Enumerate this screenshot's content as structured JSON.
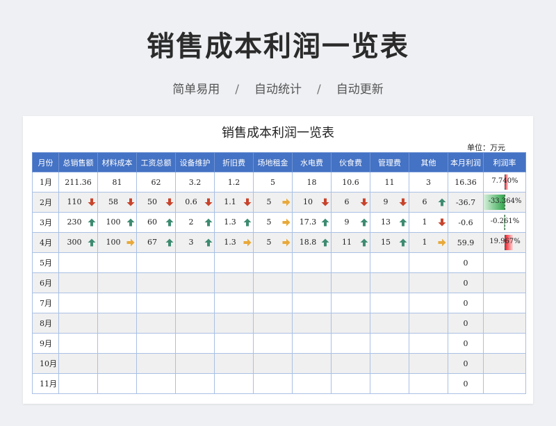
{
  "hero": {
    "title": "销售成本利润一览表",
    "tags": [
      "简单易用",
      "自动统计",
      "自动更新"
    ],
    "separator": "/"
  },
  "sheet": {
    "title": "销售成本利润一览表",
    "unit": "单位：万元",
    "headers": [
      "月份",
      "总销售额",
      "材料成本",
      "工资总额",
      "设备维护",
      "折旧费",
      "场地租金",
      "水电费",
      "伙食费",
      "管理费",
      "其他",
      "本月利润",
      "利润率"
    ],
    "rows": [
      {
        "month": "1月",
        "cells": [
          {
            "v": "211.36",
            "i": ""
          },
          {
            "v": "81",
            "i": ""
          },
          {
            "v": "62",
            "i": ""
          },
          {
            "v": "3.2",
            "i": ""
          },
          {
            "v": "1.2",
            "i": ""
          },
          {
            "v": "5",
            "i": ""
          },
          {
            "v": "18",
            "i": ""
          },
          {
            "v": "10.6",
            "i": ""
          },
          {
            "v": "11",
            "i": ""
          },
          {
            "v": "3",
            "i": ""
          }
        ],
        "profit": "16.36",
        "rate": "7.740%",
        "rate_value": 7.74
      },
      {
        "month": "2月",
        "cells": [
          {
            "v": "110",
            "i": "down"
          },
          {
            "v": "58",
            "i": "down"
          },
          {
            "v": "50",
            "i": "down"
          },
          {
            "v": "0.6",
            "i": "down"
          },
          {
            "v": "1.1",
            "i": "down"
          },
          {
            "v": "5",
            "i": "right"
          },
          {
            "v": "10",
            "i": "down"
          },
          {
            "v": "6",
            "i": "down"
          },
          {
            "v": "9",
            "i": "down"
          },
          {
            "v": "6",
            "i": "up"
          }
        ],
        "profit": "-36.7",
        "rate": "-33.364%",
        "rate_value": -33.364
      },
      {
        "month": "3月",
        "cells": [
          {
            "v": "230",
            "i": "up"
          },
          {
            "v": "100",
            "i": "up"
          },
          {
            "v": "60",
            "i": "up"
          },
          {
            "v": "2",
            "i": "up"
          },
          {
            "v": "1.3",
            "i": "up"
          },
          {
            "v": "5",
            "i": "right"
          },
          {
            "v": "17.3",
            "i": "up"
          },
          {
            "v": "9",
            "i": "up"
          },
          {
            "v": "13",
            "i": "up"
          },
          {
            "v": "1",
            "i": "down"
          }
        ],
        "profit": "-0.6",
        "rate": "-0.261%",
        "rate_value": -0.261
      },
      {
        "month": "4月",
        "cells": [
          {
            "v": "300",
            "i": "up"
          },
          {
            "v": "100",
            "i": "right"
          },
          {
            "v": "67",
            "i": "up"
          },
          {
            "v": "3",
            "i": "up"
          },
          {
            "v": "1.3",
            "i": "right"
          },
          {
            "v": "5",
            "i": "right"
          },
          {
            "v": "18.8",
            "i": "up"
          },
          {
            "v": "11",
            "i": "up"
          },
          {
            "v": "15",
            "i": "up"
          },
          {
            "v": "1",
            "i": "right"
          }
        ],
        "profit": "59.9",
        "rate": "19.967%",
        "rate_value": 19.967
      },
      {
        "month": "5月",
        "cells": [],
        "profit": "0",
        "rate": "",
        "rate_value": 0
      },
      {
        "month": "6月",
        "cells": [],
        "profit": "0",
        "rate": "",
        "rate_value": 0
      },
      {
        "month": "7月",
        "cells": [],
        "profit": "0",
        "rate": "",
        "rate_value": 0
      },
      {
        "month": "8月",
        "cells": [],
        "profit": "0",
        "rate": "",
        "rate_value": 0
      },
      {
        "month": "9月",
        "cells": [],
        "profit": "0",
        "rate": "",
        "rate_value": 0
      },
      {
        "month": "10月",
        "cells": [],
        "profit": "0",
        "rate": "",
        "rate_value": 0
      },
      {
        "month": "11月",
        "cells": [],
        "profit": "0",
        "rate": "",
        "rate_value": 0
      }
    ]
  },
  "colors": {
    "header_bg": "#4472c4",
    "arrow_up": "#3d8b70",
    "arrow_down": "#c8432b",
    "arrow_right": "#e8a93a",
    "rate_pos": "#e8141f",
    "rate_neg": "#2fa64b"
  },
  "icons": {
    "up": "arrow-up-icon",
    "down": "arrow-down-icon",
    "right": "arrow-right-icon"
  }
}
